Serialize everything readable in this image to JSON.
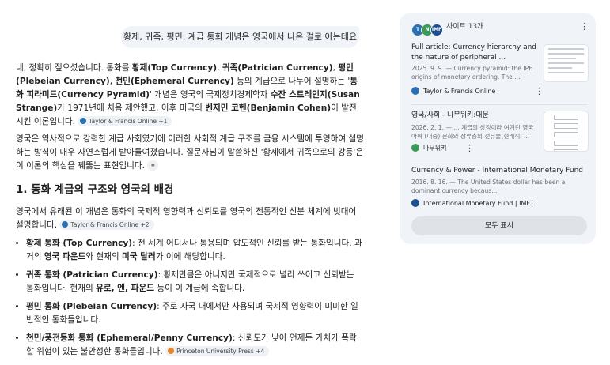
{
  "user_query": "황제, 귀족, 평민, 계급 통화 개념은 영국에서 나온 걸로 아는데요",
  "answer": {
    "p1": {
      "t1": "네, 정확히 짚으셨습니다. 통화를 ",
      "b1": "황제(Top Currency)",
      "t2": ", ",
      "b2": "귀족(Patrician Currency)",
      "t3": ", ",
      "b3": "평민(Plebeian Currency)",
      "t4": ", ",
      "b4": "천민(Ephemeral Currency)",
      "t5": " 등의 계급으로 나누어 설명하는 '",
      "b5": "통화 피라미드(Currency Pyramid)",
      "t6": "' 개념은 영국의 국제정치경제학자 ",
      "b6": "수잔 스트레인지(Susan Strange)",
      "t7": "가 1971년에 처음 제안했고, 이후 미국의 ",
      "b7": "벤저민 코헨(Benjamin Cohen)",
      "t8": "이 발전시킨 이론입니다.",
      "chip": "Taylor & Francis Online +1"
    },
    "p2": {
      "text": "영국은 역사적으로 강력한 계급 사회였기에 이러한 사회적 계급 구조를 금융 시스템에 투영하여 설명하는 방식이 매우 자연스럽게 받아들여졌습니다. 질문자님이 말씀하신 '황제에서 귀족으로의 강등'은 이 이론의 핵심을 꿰뚫는 표현입니다."
    },
    "heading": "1. 통화 계급의 구조와 영국의 배경",
    "p3": {
      "text": "영국에서 유래된 이 개념은 통화의 국제적 영향력과 신뢰도를 영국의 전통적인 신분 체계에 빗대어 설명합니다.",
      "chip": "Taylor & Francis Online +2"
    },
    "bullets": [
      {
        "term": "황제 통화 (Top Currency)",
        "t1": ": 전 세계 어디서나 통용되며 압도적인 신뢰를 받는 통화입니다. 과거의 ",
        "b1": "영국 파운드",
        "t2": "와 현재의 ",
        "b2": "미국 달러",
        "t3": "가 이에 해당합니다."
      },
      {
        "term": "귀족 통화 (Patrician Currency)",
        "t1": ": 황제만큼은 아니지만 국제적으로 널리 쓰이고 신뢰받는 통화입니다. 현재의 ",
        "b1": "유로, 엔, 파운드",
        "t2": " 등이 이 계급에 속합니다."
      },
      {
        "term": "평민 통화 (Plebeian Currency)",
        "t1": ": 주로 자국 내에서만 사용되며 국제적 영향력이 미미한 일반적인 통화들입니다."
      },
      {
        "term": "천민/풍전등화 통화 (Ephemeral/Penny Currency)",
        "t1": ": 신뢰도가 낮아 언제든 가치가 폭락할 위험이 있는 불안정한 통화들입니다.",
        "chip": "Princeton University Press +4"
      }
    ]
  },
  "sources_panel": {
    "header": "사이트 13개",
    "header_icons": [
      "T",
      "N",
      "IMF"
    ],
    "cards": [
      {
        "title": "Full article: Currency hierarchy and the nature of peripheral ...",
        "snippet": "2025. 9. 9. — Currency pyramid: the IPE origins of monetary ordering. The ...",
        "source": "Taylor & Francis Online"
      },
      {
        "title": "영국/사회 - 나무위키:대문",
        "snippet": "2026. 2. 1. — ... 계급의 상징이라 여겨던 영국 아위 (대중) 문화와 상류층의 전유물(현래식, ...",
        "source": "나무위키"
      },
      {
        "title": "Currency & Power - International Monetary Fund",
        "snippet": "2016. 8. 16. — The United States dollar has been a dominant currency becaus...",
        "source": "International Monetary Fund | IMF"
      }
    ],
    "show_all": "모두 표시"
  },
  "colors": {
    "bubble_bg": "#f0f4f9",
    "panel_bg": "#f0f4f9",
    "chip_bg": "#eef1f5",
    "text": "#1f1f1f",
    "muted": "#6b6f73"
  },
  "icons": [
    "more-vert-icon",
    "link-icon",
    "source-favicon"
  ]
}
